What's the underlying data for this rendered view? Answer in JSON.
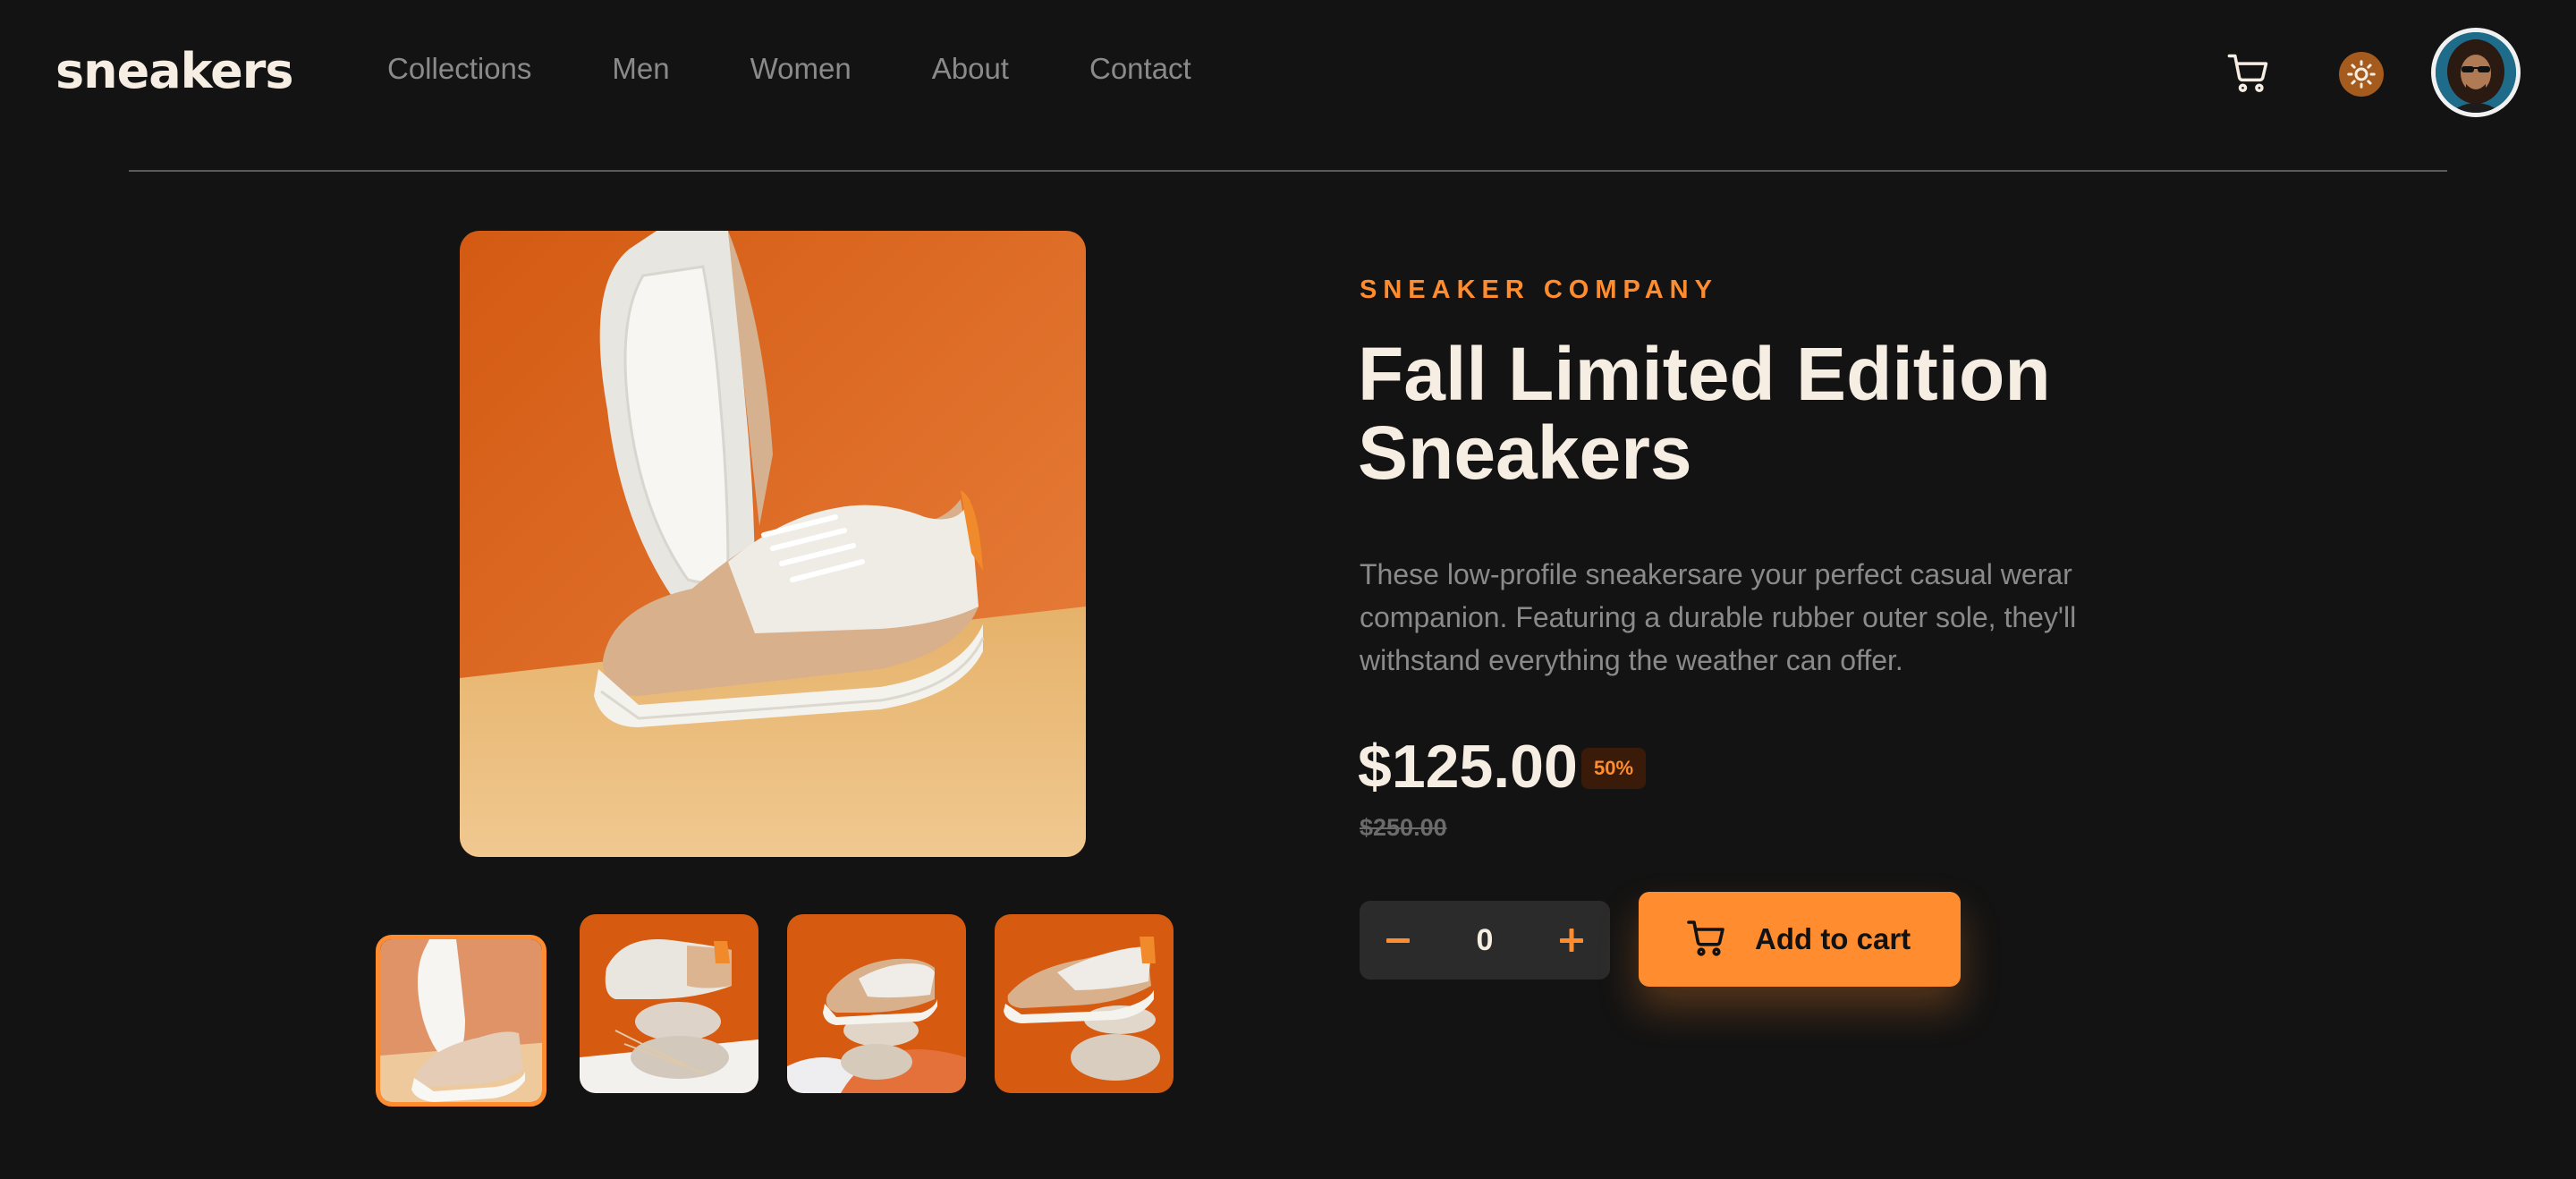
{
  "header": {
    "logo": "sneakers",
    "nav": [
      "Collections",
      "Men",
      "Women",
      "About",
      "Contact"
    ],
    "cart_icon": "cart-icon",
    "theme_icon": "sun-icon",
    "avatar": "user-avatar"
  },
  "gallery": {
    "main_image": "sneaker-sole-orange-background",
    "thumbnails": [
      "product-1",
      "product-2",
      "product-3",
      "product-4"
    ],
    "active_thumbnail": 0
  },
  "product": {
    "company": "SNEAKER COMPANY",
    "title": "Fall Limited Edition Sneakers",
    "description": "These low-profile sneakersare your perfect casual werar companion. Featuring a durable rubber outer sole, they'll withstand everything the weather can offer.",
    "price": "$125.00",
    "discount": "50%",
    "original_price": "$250.00"
  },
  "cart": {
    "quantity": "0",
    "minus_icon": "minus-icon",
    "plus_icon": "plus-icon",
    "add_label": "Add to cart"
  },
  "colors": {
    "accent": "#ff8c2f",
    "background": "#131313",
    "text": "#f6ede3",
    "muted": "#8a8a8a"
  }
}
